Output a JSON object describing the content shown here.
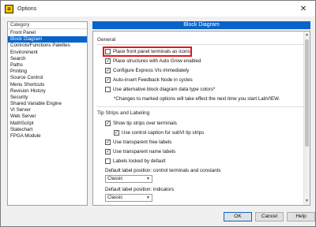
{
  "window": {
    "title": "Options",
    "close_glyph": "✕"
  },
  "categories": {
    "header": "Category",
    "items": [
      "Front Panel",
      "Block Diagram",
      "Controls/Functions Palettes",
      "Environment",
      "Search",
      "Paths",
      "Printing",
      "Source Control",
      "Menu Shortcuts",
      "Revision History",
      "Security",
      "Shared Variable Engine",
      "VI Server",
      "Web Server",
      "MathScript",
      "Statechart",
      "FPGA Module"
    ],
    "selected": "Block Diagram"
  },
  "content": {
    "header": "Block Diagram",
    "general": {
      "title": "General",
      "options": [
        {
          "label": "Place front panel terminals as icons",
          "checked": false
        },
        {
          "label": "Place structures with Auto Grow enabled",
          "checked": true
        },
        {
          "label": "Configure Express VIs immediately",
          "checked": true
        },
        {
          "label": "Auto-insert Feedback Node in cycles",
          "checked": true
        },
        {
          "label": "Use alternative block diagram data type colors*",
          "checked": false
        }
      ],
      "note": "*Changes to marked options will take effect the next time you start LabVIEW."
    },
    "tip_strips": {
      "title": "Tip Strips and Labeling",
      "options": [
        {
          "label": "Show tip strips over terminals",
          "checked": true
        },
        {
          "label": "Use control caption for subVI tip strips",
          "checked": true
        },
        {
          "label": "Use transparent free labels",
          "checked": true
        },
        {
          "label": "Use transparent name labels",
          "checked": true
        },
        {
          "label": "Labels locked by default",
          "checked": false
        }
      ],
      "control_label_position": {
        "label": "Default label position: control terminals and constants",
        "value": "Classic"
      },
      "indicator_label_position": {
        "label": "Default label position: indicators",
        "value": "Classic"
      }
    }
  },
  "buttons": {
    "ok": "OK",
    "cancel": "Cancel",
    "help": "Help"
  },
  "colors": {
    "accent": "#0a64c8",
    "highlight_box": "#e8141c"
  }
}
